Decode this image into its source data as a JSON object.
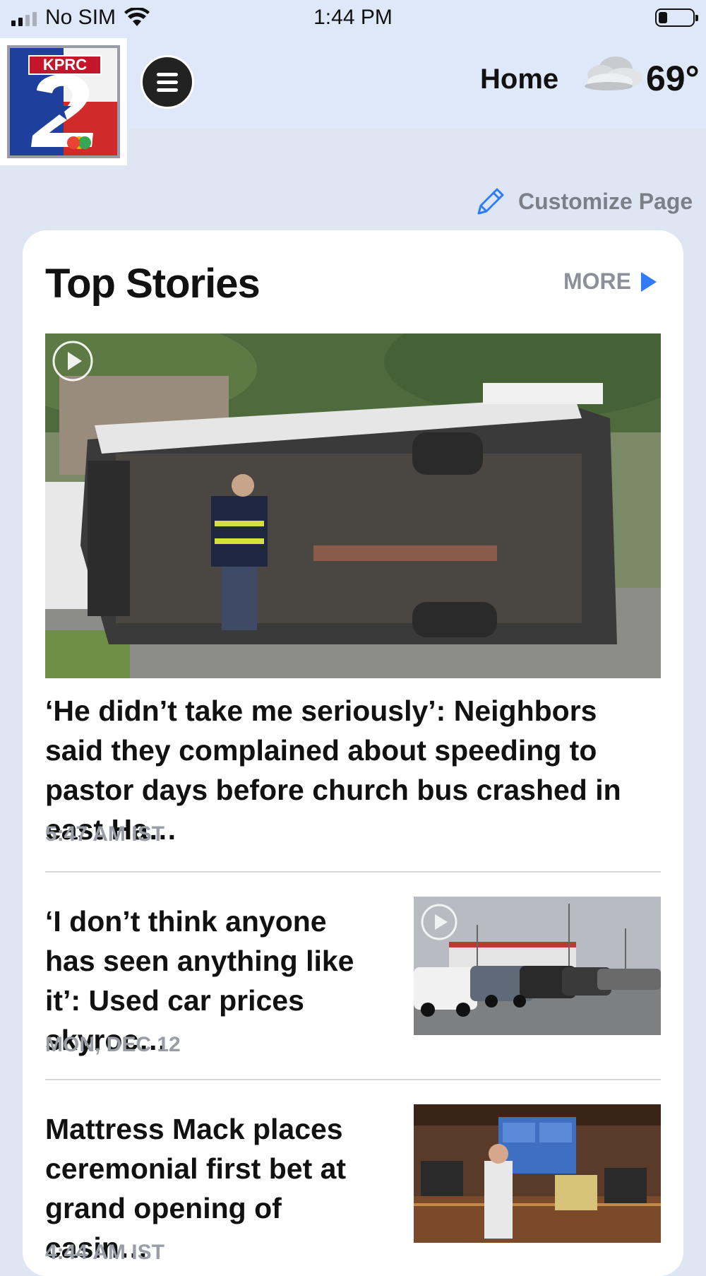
{
  "status_bar": {
    "carrier": "No SIM",
    "time": "1:44 PM",
    "battery_percent": 25
  },
  "header": {
    "logo_text": "KPRC",
    "logo_number": "2",
    "home_label": "Home",
    "weather_icon": "cloud-icon",
    "temperature": "69°"
  },
  "customize": {
    "label": "Customize Page",
    "icon": "pencil-icon"
  },
  "top_stories": {
    "title": "Top Stories",
    "more_label": "MORE",
    "lead": {
      "headline": "‘He didn’t take me seriously’: Neighbors said they complained about speeding to pastor days before church bus crashed in east Ha…",
      "time": "5:47 AM IST",
      "has_video": true
    },
    "items": [
      {
        "headline": "‘I don’t think anyone has seen anything like it’: Used car prices skyroc…",
        "time": "MON, DEC 12",
        "has_video": true
      },
      {
        "headline": "Mattress Mack places ceremonial first bet at grand opening of casin…",
        "time": "4:44 AM IST",
        "has_video": false
      }
    ]
  },
  "colors": {
    "background": "#dfe6f3",
    "accent": "#2f7cf6",
    "muted_text": "#9a9da5"
  }
}
